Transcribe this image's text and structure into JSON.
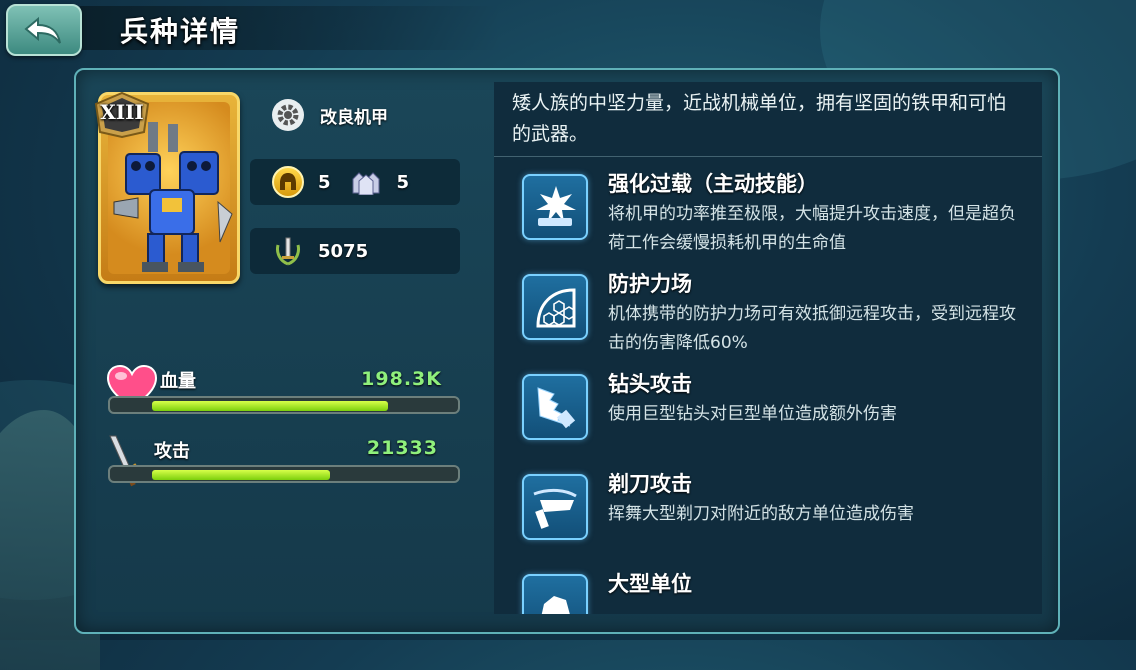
{
  "header": {
    "title": "兵种详情"
  },
  "unit": {
    "rank": "XIII",
    "name": "改良机甲",
    "stat_a": "5",
    "stat_b": "5",
    "power": "5075"
  },
  "stats": {
    "hp": {
      "label": "血量",
      "value": "198.3K",
      "fill_pct": 78
    },
    "attack": {
      "label": "攻击",
      "value": "21333",
      "fill_pct": 59
    }
  },
  "description": "矮人族的中坚力量，近战机械单位，拥有坚固的铁甲和可怕的武器。",
  "skills": [
    {
      "name": "强化过载（主动技能）",
      "desc": "将机甲的功率推至极限，大幅提升攻击速度，但是超负荷工作会缓慢损耗机甲的生命值",
      "icon": "overload-icon"
    },
    {
      "name": "防护力场",
      "desc": "机体携带的防护力场可有效抵御远程攻击，受到远程攻击的伤害降低60%",
      "icon": "force-field-icon"
    },
    {
      "name": "钻头攻击",
      "desc": "使用巨型钻头对巨型单位造成额外伤害",
      "icon": "drill-icon"
    },
    {
      "name": "剃刀攻击",
      "desc": "挥舞大型剃刀对附近的敌方单位造成伤害",
      "icon": "razor-icon"
    },
    {
      "name": "大型单位",
      "desc": "",
      "icon": "large-unit-icon"
    }
  ],
  "colors": {
    "accent": "#5fb1b8",
    "stat_green": "#8ff07c",
    "bar_fill": "#a6ec1e",
    "card_gold": "#e8b43a"
  }
}
